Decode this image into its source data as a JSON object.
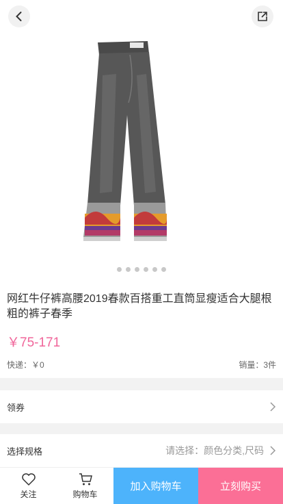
{
  "header": {
    "back_icon": "chevron-left-icon",
    "share_icon": "external-link-icon"
  },
  "gallery": {
    "image": "gray-jeans-embroidered-cuff-image",
    "indicator_count": 6
  },
  "product": {
    "title": "网红牛仔裤高腰2019春款百搭重工直筒显瘦适合大腿根粗的裤子春季",
    "price": "￥75-171",
    "shipping": "快递：￥0",
    "sales": "销量：3件",
    "price_color": "#f0659a"
  },
  "coupon": {
    "label": "领券"
  },
  "spec": {
    "label": "选择规格",
    "hint": "请选择：颜色分类,尺码"
  },
  "bottom_bar": {
    "favorite": "关注",
    "cart": "购物车",
    "add_to_cart": "加入购物车",
    "buy_now": "立刻购买",
    "add_to_cart_color": "#4db3fb",
    "buy_now_color": "#fb6f96"
  }
}
